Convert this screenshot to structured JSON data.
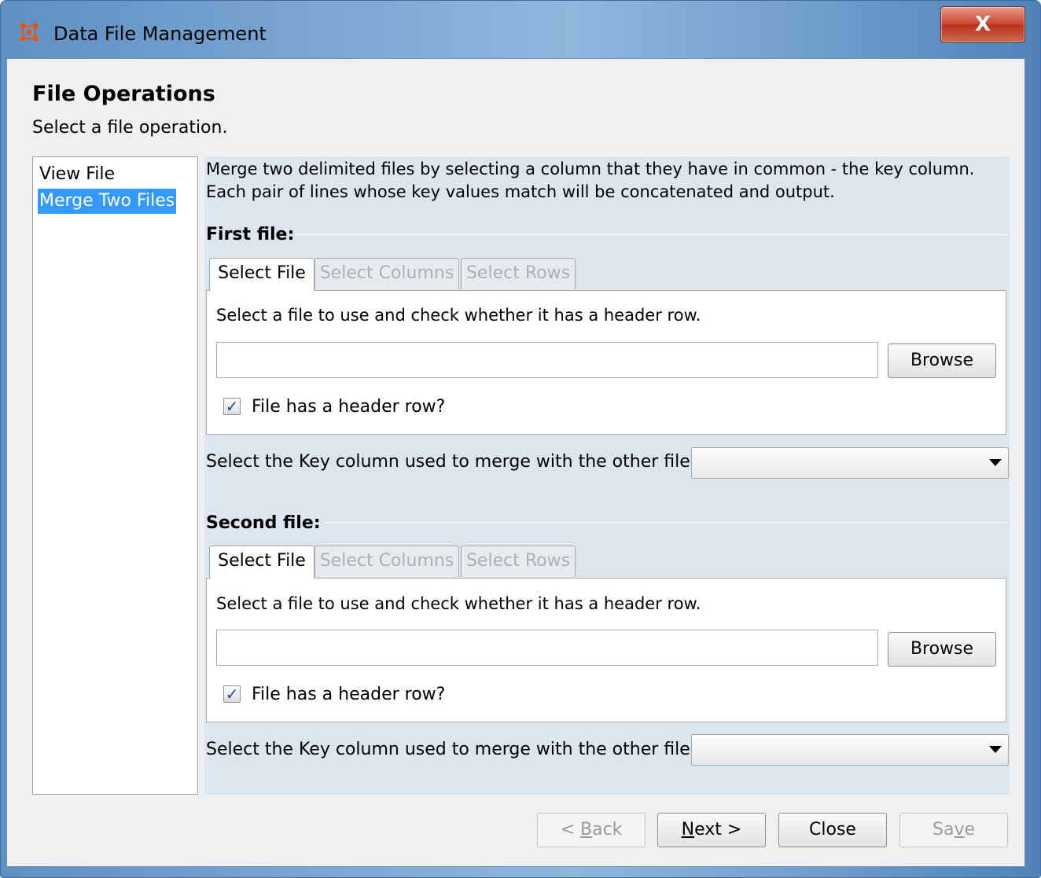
{
  "window": {
    "title": "Data File Management",
    "close_label": "X"
  },
  "header": {
    "heading": "File Operations",
    "subheading": "Select a file operation."
  },
  "operations": {
    "items": [
      {
        "label": "View File",
        "selected": false
      },
      {
        "label": "Merge Two Files",
        "selected": true
      }
    ]
  },
  "description": {
    "line1": "Merge two delimited files by selecting a column that they have in common - the key column.",
    "line2": "Each pair of lines whose key values match will be concatenated and output."
  },
  "first_file": {
    "title": "First file:",
    "tabs": [
      {
        "label": "Select File",
        "active": true
      },
      {
        "label": "Select Columns",
        "active": false
      },
      {
        "label": "Select Rows",
        "active": false
      }
    ],
    "tab_description": "Select a file to use and check whether it has a header row.",
    "file_path": "",
    "browse_label": "Browse",
    "header_checkbox": {
      "label": "File has a header row?",
      "checked": true,
      "mark": "✓"
    },
    "key_label": "Select the Key column used to merge with the other file:",
    "key_value": ""
  },
  "second_file": {
    "title": "Second file:",
    "tabs": [
      {
        "label": "Select File",
        "active": true
      },
      {
        "label": "Select Columns",
        "active": false
      },
      {
        "label": "Select Rows",
        "active": false
      }
    ],
    "tab_description": "Select a file to use and check whether it has a header row.",
    "file_path": "",
    "browse_label": "Browse",
    "header_checkbox": {
      "label": "File has a header row?",
      "checked": true,
      "mark": "✓"
    },
    "key_label": "Select the Key column used to merge with the other file:",
    "key_value": ""
  },
  "footer": {
    "back": {
      "prefix": "< ",
      "mnemonic": "B",
      "rest": "ack",
      "enabled": false
    },
    "next": {
      "mnemonic": "N",
      "rest": "ext >",
      "enabled": true
    },
    "close": {
      "label": "Close",
      "enabled": true
    },
    "save": {
      "prefix": "Sa",
      "mnemonic": "v",
      "rest": "e",
      "enabled": false
    }
  },
  "colors": {
    "selection": "#3399ff",
    "panel_bg": "#dde6ef",
    "titlebar": "#7aa6d3",
    "close_button": "#c9452f",
    "icon": "#e8540c"
  }
}
